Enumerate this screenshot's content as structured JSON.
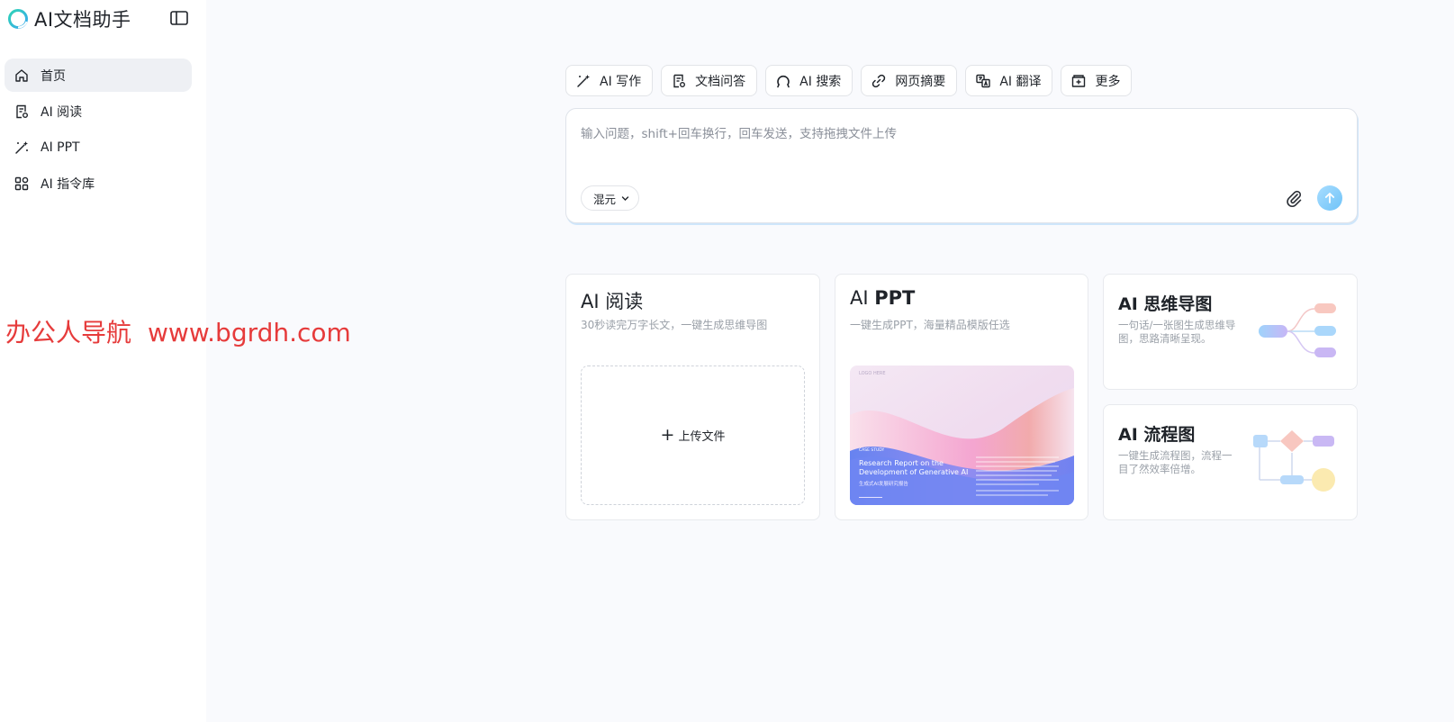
{
  "app": {
    "title": "AI文档助手"
  },
  "sidebar": {
    "items": [
      {
        "label": "首页",
        "icon": "home-icon",
        "active": true
      },
      {
        "label": "AI 阅读",
        "icon": "document-read-icon",
        "active": false
      },
      {
        "label": "AI PPT",
        "icon": "magic-wand-icon",
        "active": false
      },
      {
        "label": "AI 指令库",
        "icon": "apps-grid-icon",
        "active": false
      }
    ]
  },
  "watermark": {
    "name": "办公人导航",
    "url": "www.bgrdh.com"
  },
  "toolbar": {
    "tools": [
      {
        "label": "AI 写作",
        "icon": "magic-wand-icon"
      },
      {
        "label": "文档问答",
        "icon": "document-qa-icon"
      },
      {
        "label": "AI 搜索",
        "icon": "search-icon"
      },
      {
        "label": "网页摘要",
        "icon": "link-icon"
      },
      {
        "label": "AI 翻译",
        "icon": "translate-icon"
      },
      {
        "label": "更多",
        "icon": "more-box-icon"
      }
    ]
  },
  "composer": {
    "placeholder": "输入问题，shift+回车换行，回车发送，支持拖拽文件上传",
    "value": "",
    "model": "混元"
  },
  "cards": {
    "reading": {
      "title": "AI 阅读",
      "desc": "30秒读完万字长文，一键生成思维导图",
      "upload_label": "上传文件"
    },
    "ppt": {
      "title_prefix": "AI",
      "title_main": "PPT",
      "desc": "一键生成PPT，海量精品模版任选",
      "cover": {
        "logo": "LOGO HERE",
        "tag": "CASE STUDY",
        "heading_line1": "Research Report on the",
        "heading_line2": "Development of Generative AI",
        "subheading": "生成式AI发展研究报告"
      }
    },
    "mindmap": {
      "title": "AI 思维导图",
      "desc": "一句话/一张图生成思维导图，思路清晰呈现。"
    },
    "flowchart": {
      "title": "AI 流程图",
      "desc": "一键生成流程图，流程一目了然效率倍增。"
    }
  },
  "colors": {
    "accent": "#6fc3f8",
    "logo_teal": "#3ccfc0",
    "watermark_red": "#e63b3b"
  }
}
